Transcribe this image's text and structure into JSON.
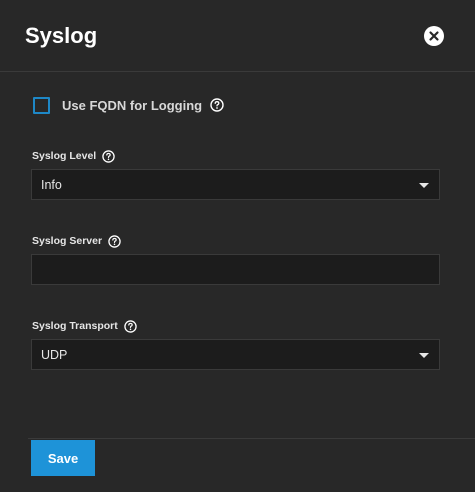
{
  "dialog": {
    "title": "Syslog"
  },
  "fqdn": {
    "label": "Use FQDN for Logging",
    "checked": false
  },
  "syslog_level": {
    "label": "Syslog Level",
    "value": "Info"
  },
  "syslog_server": {
    "label": "Syslog Server",
    "value": ""
  },
  "syslog_transport": {
    "label": "Syslog Transport",
    "value": "UDP"
  },
  "actions": {
    "save_label": "Save"
  },
  "icons": {
    "close": "close-icon",
    "help": "help-circle-icon",
    "dropdown": "chevron-down-icon"
  },
  "colors": {
    "background": "#282828",
    "field_background": "#1c1c1c",
    "accent": "#1e93d8",
    "checkbox_border": "#1e88c7"
  }
}
